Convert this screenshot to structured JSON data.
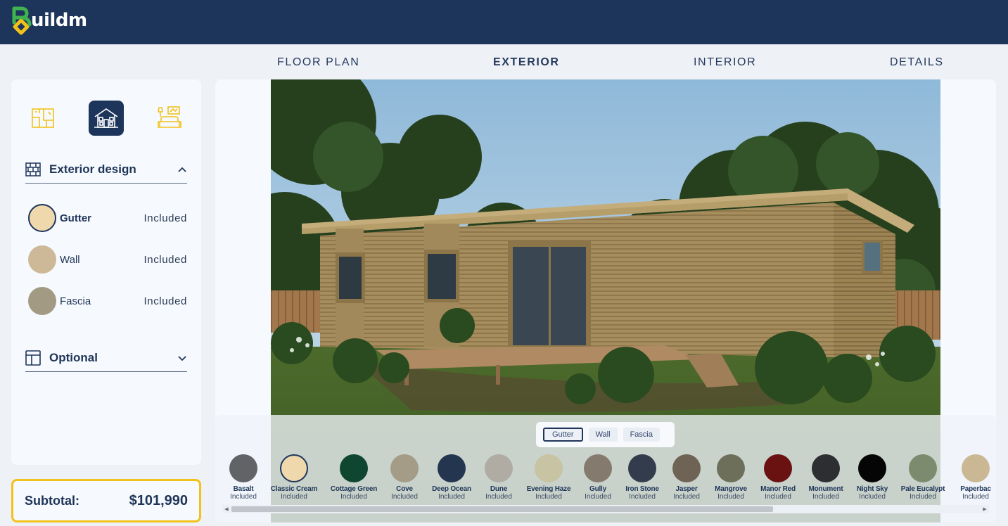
{
  "brand": {
    "name": "uildm",
    "logo_letter": "B"
  },
  "tabs": [
    {
      "label": "FLOOR PLAN",
      "active": false
    },
    {
      "label": "EXTERIOR",
      "active": true
    },
    {
      "label": "INTERIOR",
      "active": false
    },
    {
      "label": "DETAILS",
      "active": false
    }
  ],
  "sidebar": {
    "modes": [
      {
        "icon": "floor-plan-icon",
        "active": false
      },
      {
        "icon": "house-exterior-icon",
        "active": true
      },
      {
        "icon": "interior-furniture-icon",
        "active": false
      }
    ],
    "sections": [
      {
        "title": "Exterior design",
        "icon": "brick-wall-icon",
        "expanded": true,
        "items": [
          {
            "name": "Gutter",
            "value": "Included",
            "color": "#efd8ac",
            "selected": true
          },
          {
            "name": "Wall",
            "value": "Included",
            "color": "#cdb998",
            "selected": false
          },
          {
            "name": "Fascia",
            "value": "Included",
            "color": "#a39a84",
            "selected": false
          }
        ]
      },
      {
        "title": "Optional",
        "icon": "layout-panels-icon",
        "expanded": false
      }
    ]
  },
  "subtotal": {
    "label": "Subtotal:",
    "value": "$101,990"
  },
  "palette": {
    "parts": [
      {
        "label": "Gutter",
        "active": true
      },
      {
        "label": "Wall",
        "active": false
      },
      {
        "label": "Fascia",
        "active": false
      }
    ],
    "colors": [
      {
        "name": "Basalt",
        "value": "Included",
        "hex": "#626366"
      },
      {
        "name": "Classic Cream",
        "value": "Included",
        "hex": "#efd8ac",
        "selected": true
      },
      {
        "name": "Cottage Green",
        "value": "Included",
        "hex": "#0f4631"
      },
      {
        "name": "Cove",
        "value": "Included",
        "hex": "#a49c87"
      },
      {
        "name": "Deep Ocean",
        "value": "Included",
        "hex": "#23354f"
      },
      {
        "name": "Dune",
        "value": "Included",
        "hex": "#b0aca4"
      },
      {
        "name": "Evening Haze",
        "value": "Included",
        "hex": "#c8c3a2"
      },
      {
        "name": "Gully",
        "value": "Included",
        "hex": "#847a6d"
      },
      {
        "name": "Iron Stone",
        "value": "Included",
        "hex": "#323c4c"
      },
      {
        "name": "Jasper",
        "value": "Included",
        "hex": "#6e6355"
      },
      {
        "name": "Mangrove",
        "value": "Included",
        "hex": "#6d6f5b"
      },
      {
        "name": "Manor Red",
        "value": "Included",
        "hex": "#6a1212"
      },
      {
        "name": "Monument",
        "value": "Included",
        "hex": "#2c2e31"
      },
      {
        "name": "Night Sky",
        "value": "Included",
        "hex": "#050505"
      },
      {
        "name": "Pale Eucalypt",
        "value": "Included",
        "hex": "#7c8b6d"
      },
      {
        "name": "Paperbac",
        "value": "Included",
        "hex": "#cab895"
      }
    ]
  }
}
